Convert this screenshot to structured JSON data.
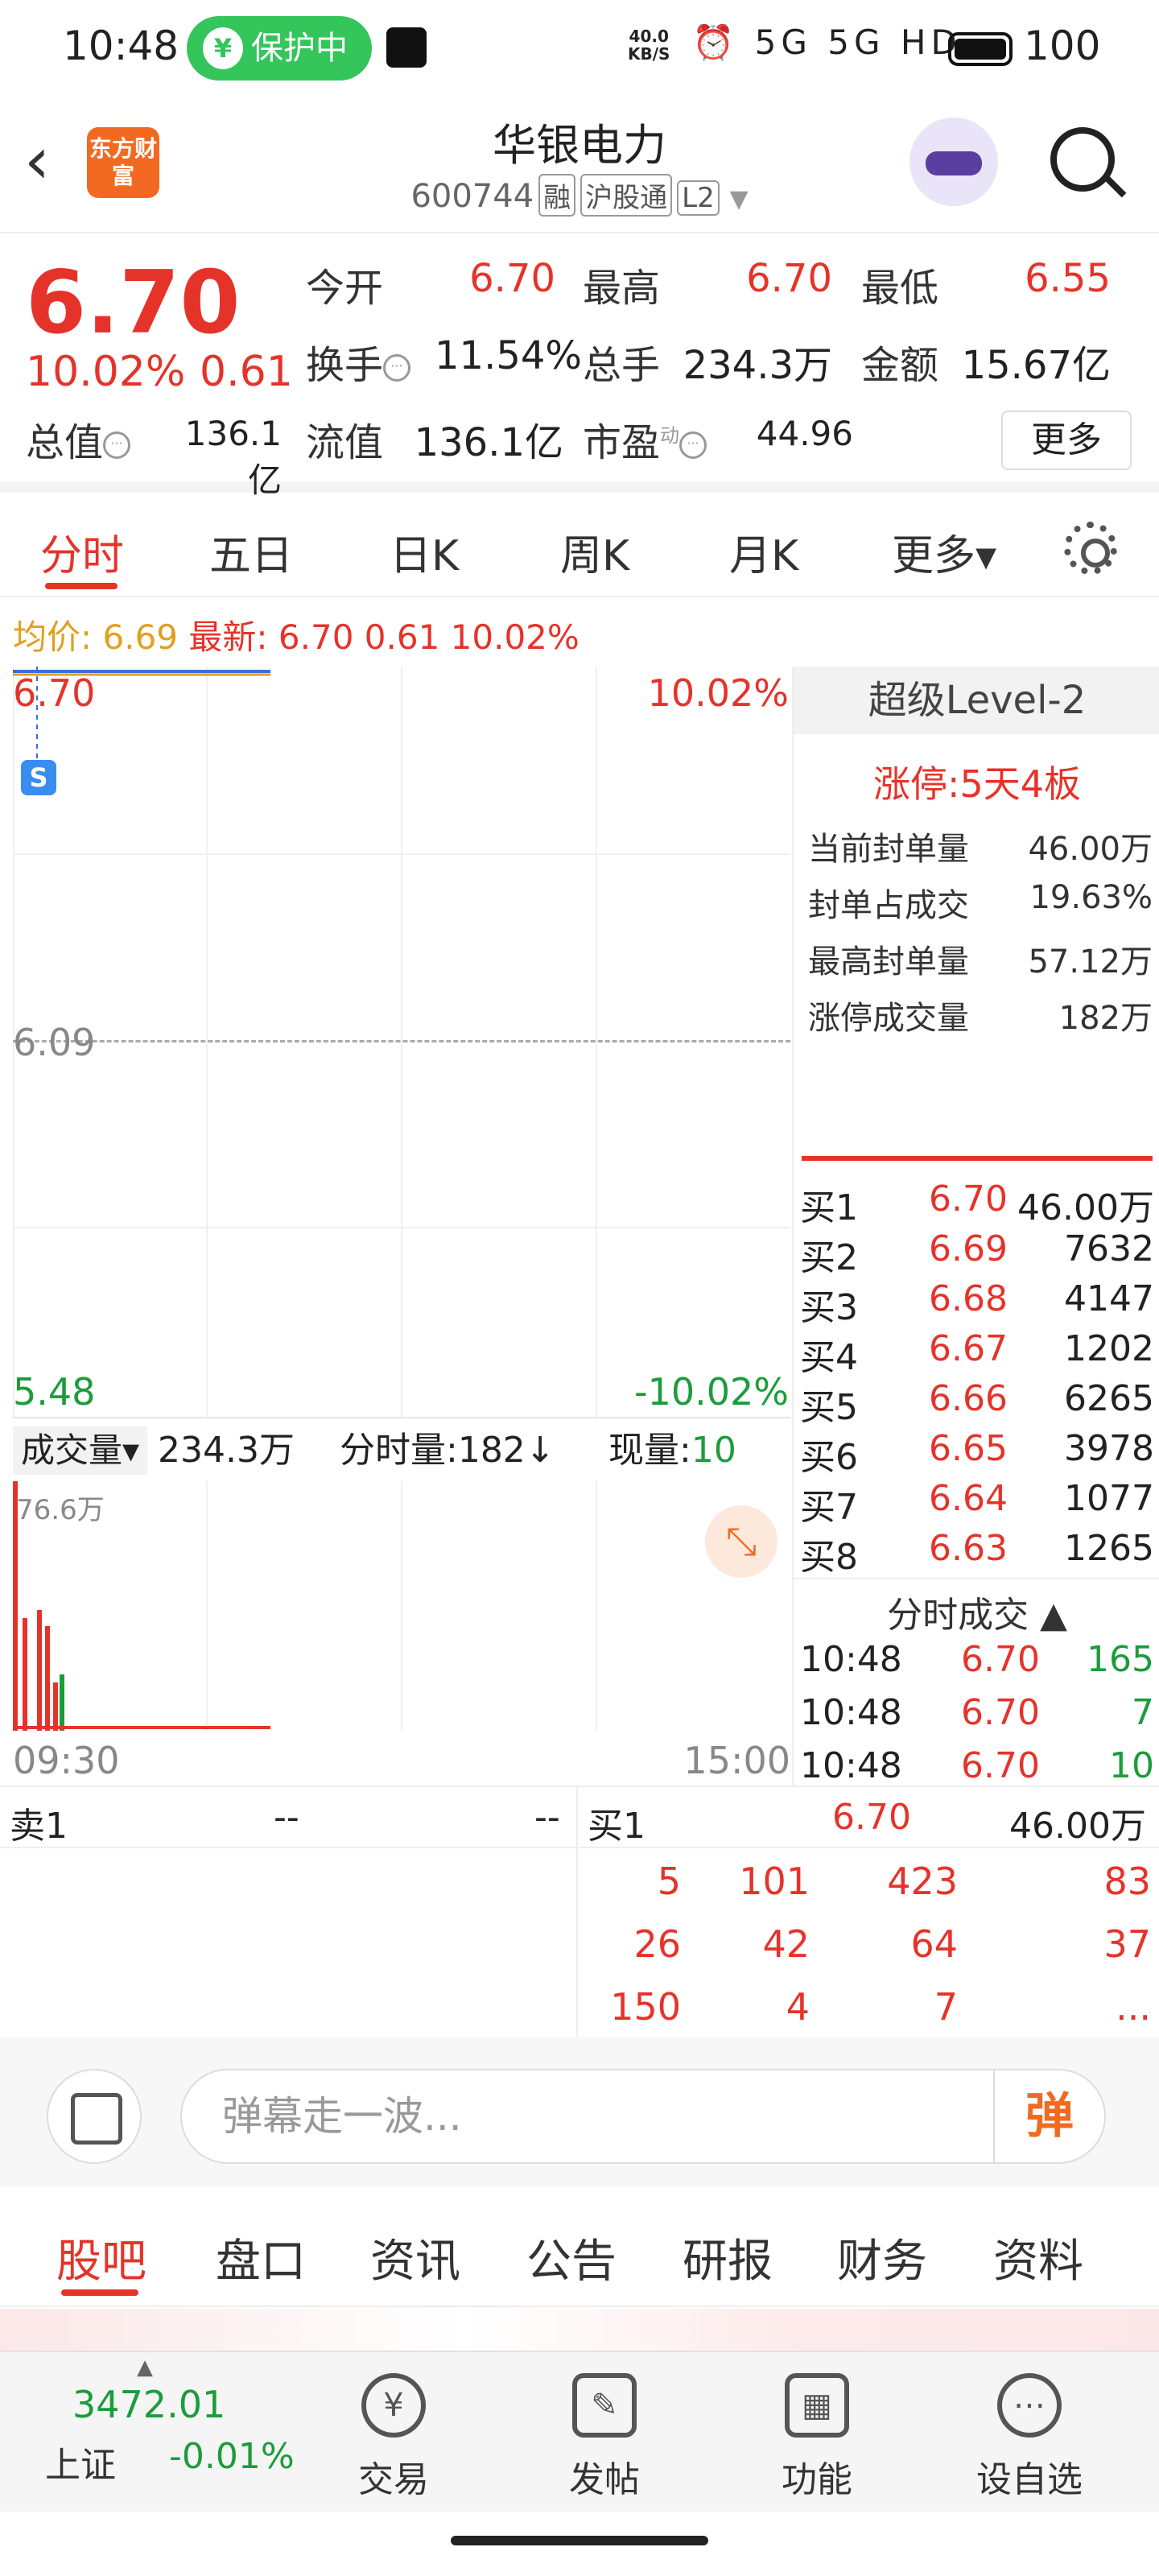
{
  "status_bar": {
    "time": "10:48",
    "protect_label": "保护中",
    "net_speed_value": "40.0",
    "net_speed_unit": "KB/S",
    "signal_icons": "⏰ 5G 5G HD",
    "battery": "100"
  },
  "header": {
    "logo_text": "东方财富",
    "stock_name": "华银电力",
    "stock_code": "600744",
    "tag_margin": "融",
    "tag_connect": "沪股通",
    "tag_level": "L2"
  },
  "quote": {
    "price": "6.70",
    "change_pct": "10.02%",
    "change": "0.61",
    "open_label": "今开",
    "open": "6.70",
    "high_label": "最高",
    "high": "6.70",
    "low_label": "最低",
    "low": "6.55",
    "turnover_label": "换手",
    "turnover": "11.54%",
    "volume_label": "总手",
    "volume": "234.3万",
    "amount_label": "金额",
    "amount": "15.67亿",
    "mktcap_label": "总值",
    "mktcap": "136.1亿",
    "float_label": "流值",
    "float": "136.1亿",
    "pe_label": "市盈",
    "pe_sup": "动",
    "pe": "44.96",
    "more_label": "更多"
  },
  "kline_tabs": [
    "分时",
    "五日",
    "日K",
    "周K",
    "月K",
    "更多▾"
  ],
  "avg_line": {
    "avg_label": "均价:",
    "avg": "6.69",
    "last_label": "最新:",
    "last": "6.70",
    "chg": "0.61",
    "pct": "10.02%"
  },
  "chart_labels": {
    "top_price": "6.70",
    "top_pct": "10.02%",
    "mid_price": "6.09",
    "bottom_price": "5.48",
    "bottom_pct": "-10.02%",
    "marker": "S",
    "time_start": "09:30",
    "time_end": "15:00"
  },
  "volume_bar": {
    "select_label": "成交量▾",
    "total": "234.3万",
    "minute_label": "分时量:182↓",
    "current_label": "现量:",
    "current": "10",
    "max_label": "76.6万"
  },
  "level2": {
    "title": "超级Level-2",
    "limit_text": "涨停:5天4板",
    "rows": [
      {
        "label": "当前封单量",
        "value": "46.00万"
      },
      {
        "label": "封单占成交",
        "value": "19.63%"
      },
      {
        "label": "最高封单量",
        "value": "57.12万"
      },
      {
        "label": "涨停成交量",
        "value": "182万"
      }
    ],
    "book": [
      {
        "label": "买1",
        "price": "6.70",
        "vol": "46.00万"
      },
      {
        "label": "买2",
        "price": "6.69",
        "vol": "7632"
      },
      {
        "label": "买3",
        "price": "6.68",
        "vol": "4147"
      },
      {
        "label": "买4",
        "price": "6.67",
        "vol": "1202"
      },
      {
        "label": "买5",
        "price": "6.66",
        "vol": "6265"
      },
      {
        "label": "买6",
        "price": "6.65",
        "vol": "3978"
      },
      {
        "label": "买7",
        "price": "6.64",
        "vol": "1077"
      },
      {
        "label": "买8",
        "price": "6.63",
        "vol": "1265"
      }
    ],
    "trades_title": "分时成交",
    "trades": [
      {
        "time": "10:48",
        "price": "6.70",
        "vol": "165"
      },
      {
        "time": "10:48",
        "price": "6.70",
        "vol": "7"
      },
      {
        "time": "10:48",
        "price": "6.70",
        "vol": "10"
      }
    ]
  },
  "bid_row": {
    "sell_label": "卖1",
    "sell_price": "--",
    "sell_vol": "--",
    "buy_label": "买1",
    "buy_price": "6.70",
    "buy_vol": "46.00万"
  },
  "queue": [
    [
      "5",
      "101",
      "423",
      "83"
    ],
    [
      "26",
      "42",
      "64",
      "37"
    ],
    [
      "150",
      "4",
      "7",
      "..."
    ]
  ],
  "danmu": {
    "placeholder": "弹幕走一波...",
    "button": "弹"
  },
  "bottom_tabs": [
    "股吧",
    "盘口",
    "资讯",
    "公告",
    "研报",
    "财务",
    "资料"
  ],
  "nav": {
    "index_value": "3472.01",
    "index_name": "上证",
    "index_change": "-0.01%",
    "items": [
      {
        "icon": "¥",
        "label": "交易"
      },
      {
        "icon": "✎",
        "label": "发帖"
      },
      {
        "icon": "▦",
        "label": "功能"
      },
      {
        "icon": "⋯",
        "label": "设自选"
      }
    ]
  },
  "chart_data": {
    "type": "line",
    "series": [
      {
        "values": [
          6.7,
          6.7
        ]
      }
    ],
    "ylim": [
      5.48,
      6.7
    ]
  },
  "colors": {
    "up": "#e6332a",
    "down": "#1c9c3b",
    "accent": "#f26a21",
    "avg_line": "#e0a020"
  }
}
